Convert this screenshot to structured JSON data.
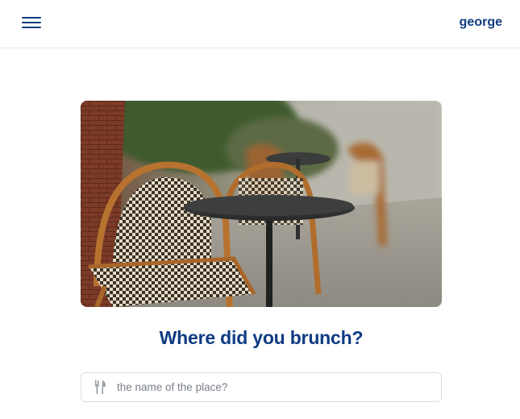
{
  "header": {
    "menu_icon": "hamburger-menu-icon",
    "username": "george"
  },
  "hero": {
    "image_subject": "outdoor cafe tables and wicker bistro chairs on a sidewalk"
  },
  "main": {
    "question": "Where did you brunch?",
    "place_input": {
      "icon": "fork-knife-icon",
      "placeholder": "the name of the place?",
      "value": ""
    }
  },
  "colors": {
    "brand": "#0f3b82",
    "border": "#d9dde3",
    "placeholder": "#7b8088"
  }
}
